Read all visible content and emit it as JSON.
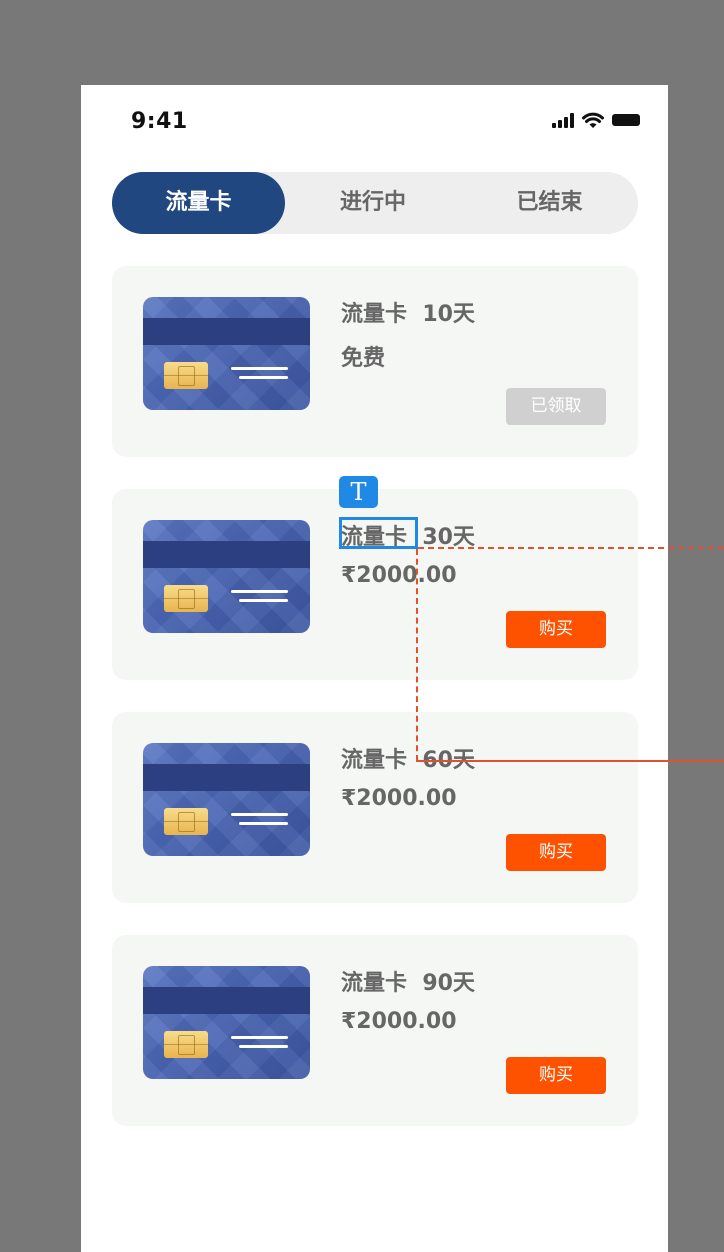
{
  "status_bar": {
    "time": "9:41"
  },
  "tabs": [
    {
      "label": "流量卡",
      "active": true
    },
    {
      "label": "进行中",
      "active": false
    },
    {
      "label": "已结束",
      "active": false
    }
  ],
  "items": [
    {
      "title": "流量卡  10天",
      "price": "免费",
      "button": "已领取",
      "button_state": "claimed"
    },
    {
      "title": "流量卡  30天",
      "price": "₹2000.00",
      "button": "购买",
      "button_state": "buy"
    },
    {
      "title": "流量卡  60天",
      "price": "₹2000.00",
      "button": "购买",
      "button_state": "buy"
    },
    {
      "title": "流量卡  90天",
      "price": "₹2000.00",
      "button": "购买",
      "button_state": "buy"
    }
  ],
  "colors": {
    "accent": "#214781",
    "buy_button": "#ff5200",
    "claimed_button": "#d0d0d0",
    "selection": "#1f89e5",
    "guide": "#e0522d"
  },
  "overlay": {
    "text_tool_icon": "text-tool-icon",
    "text_tool_glyph": "T"
  }
}
